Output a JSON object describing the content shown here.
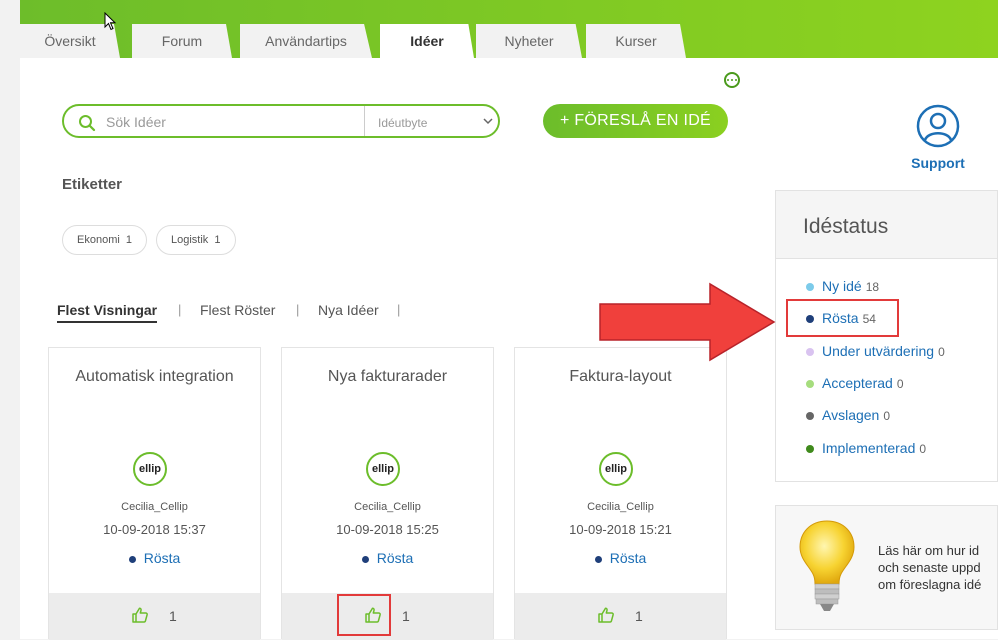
{
  "tabs": [
    {
      "label": "Översikt"
    },
    {
      "label": "Forum"
    },
    {
      "label": "Användartips"
    },
    {
      "label": "Idéer"
    },
    {
      "label": "Nyheter"
    },
    {
      "label": "Kurser"
    }
  ],
  "active_tab": "Idéer",
  "search": {
    "placeholder": "Sök Idéer",
    "filter_value": "Idéutbyte"
  },
  "propose_button": "+ FÖRESLÅ EN IDÉ",
  "support": {
    "label": "Support"
  },
  "tags": {
    "title": "Etiketter",
    "items": [
      {
        "label": "Ekonomi",
        "count": "1"
      },
      {
        "label": "Logistik",
        "count": "1"
      }
    ]
  },
  "sort_tabs": [
    {
      "label": "Flest Visningar"
    },
    {
      "label": "Flest Röster"
    },
    {
      "label": "Nya Idéer"
    }
  ],
  "ideas": [
    {
      "title": "Automatisk integration",
      "logo": "ellip",
      "author": "Cecilia_Cellip",
      "date": "10-09-2018 15:37",
      "status": "Rösta",
      "votes": "1"
    },
    {
      "title": "Nya fakturarader",
      "logo": "ellip",
      "author": "Cecilia_Cellip",
      "date": "10-09-2018 15:25",
      "status": "Rösta",
      "votes": "1"
    },
    {
      "title": "Faktura-layout",
      "logo": "ellip",
      "author": "Cecilia_Cellip",
      "date": "10-09-2018 15:21",
      "status": "Rösta",
      "votes": "1"
    }
  ],
  "idea_status": {
    "title": "Idéstatus",
    "items": [
      {
        "label": "Ny idé",
        "count": "18",
        "color": "#7ccbea"
      },
      {
        "label": "Rösta",
        "count": "54",
        "color": "#1f3f7a"
      },
      {
        "label": "Under utvärdering",
        "count": "0",
        "color": "#d9c3f0"
      },
      {
        "label": "Accepterad",
        "count": "0",
        "color": "#a6dd7e"
      },
      {
        "label": "Avslagen",
        "count": "0",
        "color": "#666666"
      },
      {
        "label": "Implementerad",
        "count": "0",
        "color": "#3f8a1c"
      }
    ]
  },
  "info_box": {
    "line1": "Läs här om hur id",
    "line2": "och senaste uppd",
    "line3": "om föreslagna idé"
  },
  "colors": {
    "brand_green": "#6cbd2b",
    "link_blue": "#1d6fb5",
    "highlight_red": "#e23a3a"
  }
}
